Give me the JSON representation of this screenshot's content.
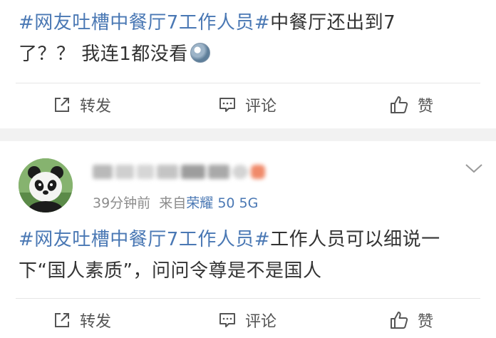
{
  "post1": {
    "topic": "#网友吐槽中餐厅7工作人员#",
    "text_line1_rest": "中餐厅还出到7",
    "text_line2": "了？？ 我连1都没看",
    "emoji": "husky-face-icon"
  },
  "actions": {
    "repost": "转发",
    "comment": "评论",
    "like": "赞"
  },
  "post2": {
    "time": "39分钟前",
    "source_prefix": "来自",
    "device": "荣耀 50 5G",
    "topic": "#网友吐槽中餐厅7工作人员#",
    "text_line1_rest": "工作人员可以细说一",
    "text_line2": "下“国人素质”，问问令尊是不是国人"
  },
  "colors": {
    "link": "#4a78b4",
    "text": "#333333",
    "meta": "#8c8c8c",
    "gap": "#f2f2f2"
  }
}
